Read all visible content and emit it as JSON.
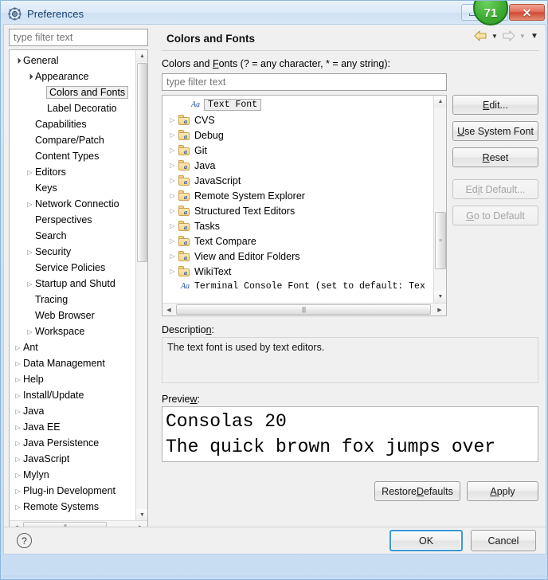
{
  "window": {
    "title": "Preferences",
    "icon": "preferences-gear-icon",
    "badge_value": "71",
    "badge_color": "#3fae34",
    "minimize_label": "Minimize",
    "maximize_label": "Maximize",
    "close_label": "Close"
  },
  "sidebar": {
    "filter_placeholder": "type filter text",
    "items": [
      {
        "label": "General",
        "indent": 0,
        "arrow": "open",
        "selected": false
      },
      {
        "label": "Appearance",
        "indent": 1,
        "arrow": "open",
        "selected": false
      },
      {
        "label": "Colors and Fonts",
        "indent": 2,
        "arrow": "none",
        "selected": true
      },
      {
        "label": "Label Decoratio",
        "indent": 2,
        "arrow": "none",
        "selected": false
      },
      {
        "label": "Capabilities",
        "indent": 1,
        "arrow": "none",
        "selected": false
      },
      {
        "label": "Compare/Patch",
        "indent": 1,
        "arrow": "none",
        "selected": false
      },
      {
        "label": "Content Types",
        "indent": 1,
        "arrow": "none",
        "selected": false
      },
      {
        "label": "Editors",
        "indent": 1,
        "arrow": "closed",
        "selected": false
      },
      {
        "label": "Keys",
        "indent": 1,
        "arrow": "none",
        "selected": false
      },
      {
        "label": "Network Connectio",
        "indent": 1,
        "arrow": "closed",
        "selected": false
      },
      {
        "label": "Perspectives",
        "indent": 1,
        "arrow": "none",
        "selected": false
      },
      {
        "label": "Search",
        "indent": 1,
        "arrow": "none",
        "selected": false
      },
      {
        "label": "Security",
        "indent": 1,
        "arrow": "closed",
        "selected": false
      },
      {
        "label": "Service Policies",
        "indent": 1,
        "arrow": "none",
        "selected": false
      },
      {
        "label": "Startup and Shutd",
        "indent": 1,
        "arrow": "closed",
        "selected": false
      },
      {
        "label": "Tracing",
        "indent": 1,
        "arrow": "none",
        "selected": false
      },
      {
        "label": "Web Browser",
        "indent": 1,
        "arrow": "none",
        "selected": false
      },
      {
        "label": "Workspace",
        "indent": 1,
        "arrow": "closed",
        "selected": false
      },
      {
        "label": "Ant",
        "indent": 0,
        "arrow": "closed",
        "selected": false
      },
      {
        "label": "Data Management",
        "indent": 0,
        "arrow": "closed",
        "selected": false
      },
      {
        "label": "Help",
        "indent": 0,
        "arrow": "closed",
        "selected": false
      },
      {
        "label": "Install/Update",
        "indent": 0,
        "arrow": "closed",
        "selected": false
      },
      {
        "label": "Java",
        "indent": 0,
        "arrow": "closed",
        "selected": false
      },
      {
        "label": "Java EE",
        "indent": 0,
        "arrow": "closed",
        "selected": false
      },
      {
        "label": "Java Persistence",
        "indent": 0,
        "arrow": "closed",
        "selected": false
      },
      {
        "label": "JavaScript",
        "indent": 0,
        "arrow": "closed",
        "selected": false
      },
      {
        "label": "Mylyn",
        "indent": 0,
        "arrow": "closed",
        "selected": false
      },
      {
        "label": "Plug-in Development",
        "indent": 0,
        "arrow": "closed",
        "selected": false
      },
      {
        "label": "Remote Systems",
        "indent": 0,
        "arrow": "closed",
        "selected": false
      }
    ]
  },
  "page": {
    "title": "Colors and Fonts",
    "nav": {
      "back": "back-arrow",
      "back_menu": "back-dropdown",
      "forward": "forward-arrow",
      "forward_menu": "forward-dropdown",
      "view_menu": "view-menu"
    },
    "filter_label_pre": "Colors and ",
    "filter_label_mnemonic": "F",
    "filter_label_post": "onts (? = any character, * = any string):",
    "filter_placeholder": "type filter text",
    "tree": [
      {
        "label": "Text Font",
        "kind": "font",
        "arrow": "none",
        "selected": true,
        "mono": false
      },
      {
        "label": "CVS",
        "kind": "folder",
        "arrow": "closed",
        "selected": false,
        "mono": false
      },
      {
        "label": "Debug",
        "kind": "folder",
        "arrow": "closed",
        "selected": false,
        "mono": false
      },
      {
        "label": "Git",
        "kind": "folder",
        "arrow": "closed",
        "selected": false,
        "mono": false
      },
      {
        "label": "Java",
        "kind": "folder",
        "arrow": "closed",
        "selected": false,
        "mono": false
      },
      {
        "label": "JavaScript",
        "kind": "folder",
        "arrow": "closed",
        "selected": false,
        "mono": false
      },
      {
        "label": "Remote System Explorer",
        "kind": "folder",
        "arrow": "closed",
        "selected": false,
        "mono": false
      },
      {
        "label": "Structured Text Editors",
        "kind": "folder",
        "arrow": "closed",
        "selected": false,
        "mono": false
      },
      {
        "label": "Tasks",
        "kind": "folder",
        "arrow": "closed",
        "selected": false,
        "mono": false
      },
      {
        "label": "Text Compare",
        "kind": "folder",
        "arrow": "closed",
        "selected": false,
        "mono": false
      },
      {
        "label": "View and Editor Folders",
        "kind": "folder",
        "arrow": "closed",
        "selected": false,
        "mono": false
      },
      {
        "label": "WikiText",
        "kind": "folder",
        "arrow": "closed",
        "selected": false,
        "mono": false
      },
      {
        "label": "Terminal Console Font (set to default: Tex",
        "kind": "font",
        "arrow": "none",
        "selected": false,
        "mono": true
      }
    ],
    "buttons": [
      {
        "pre": "",
        "mnemonic": "E",
        "post": "dit...",
        "disabled": false,
        "name": "edit-button"
      },
      {
        "pre": "",
        "mnemonic": "U",
        "post": "se System Font",
        "disabled": false,
        "name": "use-system-font-button"
      },
      {
        "pre": "",
        "mnemonic": "R",
        "post": "eset",
        "disabled": false,
        "name": "reset-button"
      },
      {
        "pre": "Ed",
        "mnemonic": "i",
        "post": "t Default...",
        "disabled": true,
        "name": "edit-default-button"
      },
      {
        "pre": "",
        "mnemonic": "G",
        "post": "o to Default",
        "disabled": true,
        "name": "go-to-default-button"
      }
    ],
    "description_label_pre": "Descriptio",
    "description_label_mnemonic": "n",
    "description_label_post": ":",
    "description_text": "The text font is used by text editors.",
    "preview_label_pre": "Previe",
    "preview_label_mnemonic": "w",
    "preview_label_post": ":",
    "preview_lines": [
      "Consolas 20",
      "The quick brown fox jumps over"
    ],
    "restore_defaults_pre": "Restore ",
    "restore_defaults_mnemonic": "D",
    "restore_defaults_post": "efaults",
    "apply_pre": "",
    "apply_mnemonic": "A",
    "apply_post": "pply"
  },
  "footer": {
    "help_icon": "help-question-icon",
    "ok_label": "OK",
    "cancel_label": "Cancel"
  }
}
